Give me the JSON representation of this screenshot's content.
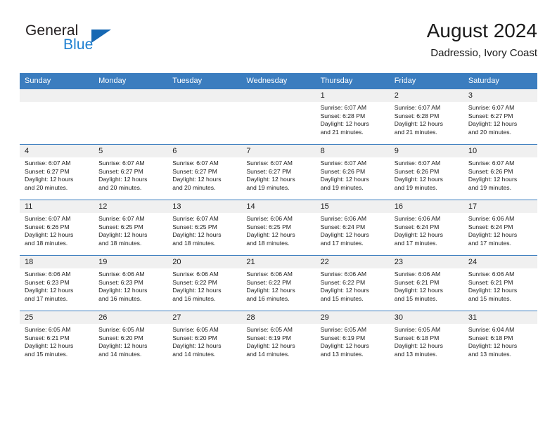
{
  "brand": {
    "line1": "General",
    "line2": "Blue",
    "triangle_color": "#1668b3",
    "blue_color": "#1d7fd0"
  },
  "header": {
    "title": "August 2024",
    "subtitle": "Dadressio, Ivory Coast"
  },
  "theme": {
    "header_row_bg": "#3b7dbf",
    "daynum_bg": "#f0f0f0",
    "grid_line": "#3b7dbf",
    "text": "#1a1a1a"
  },
  "weekday_headers": [
    "Sunday",
    "Monday",
    "Tuesday",
    "Wednesday",
    "Thursday",
    "Friday",
    "Saturday"
  ],
  "labels": {
    "sunrise_prefix": "Sunrise:",
    "sunset_prefix": "Sunset:",
    "daylight_prefix": "Daylight:"
  },
  "weeks": [
    [
      {
        "day": "",
        "blank": true
      },
      {
        "day": "",
        "blank": true
      },
      {
        "day": "",
        "blank": true
      },
      {
        "day": "",
        "blank": true
      },
      {
        "day": "1",
        "sunrise": "Sunrise: 6:07 AM",
        "sunset": "Sunset: 6:28 PM",
        "daylight_l1": "Daylight: 12 hours",
        "daylight_l2": "and 21 minutes."
      },
      {
        "day": "2",
        "sunrise": "Sunrise: 6:07 AM",
        "sunset": "Sunset: 6:28 PM",
        "daylight_l1": "Daylight: 12 hours",
        "daylight_l2": "and 21 minutes."
      },
      {
        "day": "3",
        "sunrise": "Sunrise: 6:07 AM",
        "sunset": "Sunset: 6:27 PM",
        "daylight_l1": "Daylight: 12 hours",
        "daylight_l2": "and 20 minutes."
      }
    ],
    [
      {
        "day": "4",
        "sunrise": "Sunrise: 6:07 AM",
        "sunset": "Sunset: 6:27 PM",
        "daylight_l1": "Daylight: 12 hours",
        "daylight_l2": "and 20 minutes."
      },
      {
        "day": "5",
        "sunrise": "Sunrise: 6:07 AM",
        "sunset": "Sunset: 6:27 PM",
        "daylight_l1": "Daylight: 12 hours",
        "daylight_l2": "and 20 minutes."
      },
      {
        "day": "6",
        "sunrise": "Sunrise: 6:07 AM",
        "sunset": "Sunset: 6:27 PM",
        "daylight_l1": "Daylight: 12 hours",
        "daylight_l2": "and 20 minutes."
      },
      {
        "day": "7",
        "sunrise": "Sunrise: 6:07 AM",
        "sunset": "Sunset: 6:27 PM",
        "daylight_l1": "Daylight: 12 hours",
        "daylight_l2": "and 19 minutes."
      },
      {
        "day": "8",
        "sunrise": "Sunrise: 6:07 AM",
        "sunset": "Sunset: 6:26 PM",
        "daylight_l1": "Daylight: 12 hours",
        "daylight_l2": "and 19 minutes."
      },
      {
        "day": "9",
        "sunrise": "Sunrise: 6:07 AM",
        "sunset": "Sunset: 6:26 PM",
        "daylight_l1": "Daylight: 12 hours",
        "daylight_l2": "and 19 minutes."
      },
      {
        "day": "10",
        "sunrise": "Sunrise: 6:07 AM",
        "sunset": "Sunset: 6:26 PM",
        "daylight_l1": "Daylight: 12 hours",
        "daylight_l2": "and 19 minutes."
      }
    ],
    [
      {
        "day": "11",
        "sunrise": "Sunrise: 6:07 AM",
        "sunset": "Sunset: 6:26 PM",
        "daylight_l1": "Daylight: 12 hours",
        "daylight_l2": "and 18 minutes."
      },
      {
        "day": "12",
        "sunrise": "Sunrise: 6:07 AM",
        "sunset": "Sunset: 6:25 PM",
        "daylight_l1": "Daylight: 12 hours",
        "daylight_l2": "and 18 minutes."
      },
      {
        "day": "13",
        "sunrise": "Sunrise: 6:07 AM",
        "sunset": "Sunset: 6:25 PM",
        "daylight_l1": "Daylight: 12 hours",
        "daylight_l2": "and 18 minutes."
      },
      {
        "day": "14",
        "sunrise": "Sunrise: 6:06 AM",
        "sunset": "Sunset: 6:25 PM",
        "daylight_l1": "Daylight: 12 hours",
        "daylight_l2": "and 18 minutes."
      },
      {
        "day": "15",
        "sunrise": "Sunrise: 6:06 AM",
        "sunset": "Sunset: 6:24 PM",
        "daylight_l1": "Daylight: 12 hours",
        "daylight_l2": "and 17 minutes."
      },
      {
        "day": "16",
        "sunrise": "Sunrise: 6:06 AM",
        "sunset": "Sunset: 6:24 PM",
        "daylight_l1": "Daylight: 12 hours",
        "daylight_l2": "and 17 minutes."
      },
      {
        "day": "17",
        "sunrise": "Sunrise: 6:06 AM",
        "sunset": "Sunset: 6:24 PM",
        "daylight_l1": "Daylight: 12 hours",
        "daylight_l2": "and 17 minutes."
      }
    ],
    [
      {
        "day": "18",
        "sunrise": "Sunrise: 6:06 AM",
        "sunset": "Sunset: 6:23 PM",
        "daylight_l1": "Daylight: 12 hours",
        "daylight_l2": "and 17 minutes."
      },
      {
        "day": "19",
        "sunrise": "Sunrise: 6:06 AM",
        "sunset": "Sunset: 6:23 PM",
        "daylight_l1": "Daylight: 12 hours",
        "daylight_l2": "and 16 minutes."
      },
      {
        "day": "20",
        "sunrise": "Sunrise: 6:06 AM",
        "sunset": "Sunset: 6:22 PM",
        "daylight_l1": "Daylight: 12 hours",
        "daylight_l2": "and 16 minutes."
      },
      {
        "day": "21",
        "sunrise": "Sunrise: 6:06 AM",
        "sunset": "Sunset: 6:22 PM",
        "daylight_l1": "Daylight: 12 hours",
        "daylight_l2": "and 16 minutes."
      },
      {
        "day": "22",
        "sunrise": "Sunrise: 6:06 AM",
        "sunset": "Sunset: 6:22 PM",
        "daylight_l1": "Daylight: 12 hours",
        "daylight_l2": "and 15 minutes."
      },
      {
        "day": "23",
        "sunrise": "Sunrise: 6:06 AM",
        "sunset": "Sunset: 6:21 PM",
        "daylight_l1": "Daylight: 12 hours",
        "daylight_l2": "and 15 minutes."
      },
      {
        "day": "24",
        "sunrise": "Sunrise: 6:06 AM",
        "sunset": "Sunset: 6:21 PM",
        "daylight_l1": "Daylight: 12 hours",
        "daylight_l2": "and 15 minutes."
      }
    ],
    [
      {
        "day": "25",
        "sunrise": "Sunrise: 6:05 AM",
        "sunset": "Sunset: 6:21 PM",
        "daylight_l1": "Daylight: 12 hours",
        "daylight_l2": "and 15 minutes."
      },
      {
        "day": "26",
        "sunrise": "Sunrise: 6:05 AM",
        "sunset": "Sunset: 6:20 PM",
        "daylight_l1": "Daylight: 12 hours",
        "daylight_l2": "and 14 minutes."
      },
      {
        "day": "27",
        "sunrise": "Sunrise: 6:05 AM",
        "sunset": "Sunset: 6:20 PM",
        "daylight_l1": "Daylight: 12 hours",
        "daylight_l2": "and 14 minutes."
      },
      {
        "day": "28",
        "sunrise": "Sunrise: 6:05 AM",
        "sunset": "Sunset: 6:19 PM",
        "daylight_l1": "Daylight: 12 hours",
        "daylight_l2": "and 14 minutes."
      },
      {
        "day": "29",
        "sunrise": "Sunrise: 6:05 AM",
        "sunset": "Sunset: 6:19 PM",
        "daylight_l1": "Daylight: 12 hours",
        "daylight_l2": "and 13 minutes."
      },
      {
        "day": "30",
        "sunrise": "Sunrise: 6:05 AM",
        "sunset": "Sunset: 6:18 PM",
        "daylight_l1": "Daylight: 12 hours",
        "daylight_l2": "and 13 minutes."
      },
      {
        "day": "31",
        "sunrise": "Sunrise: 6:04 AM",
        "sunset": "Sunset: 6:18 PM",
        "daylight_l1": "Daylight: 12 hours",
        "daylight_l2": "and 13 minutes."
      }
    ]
  ]
}
